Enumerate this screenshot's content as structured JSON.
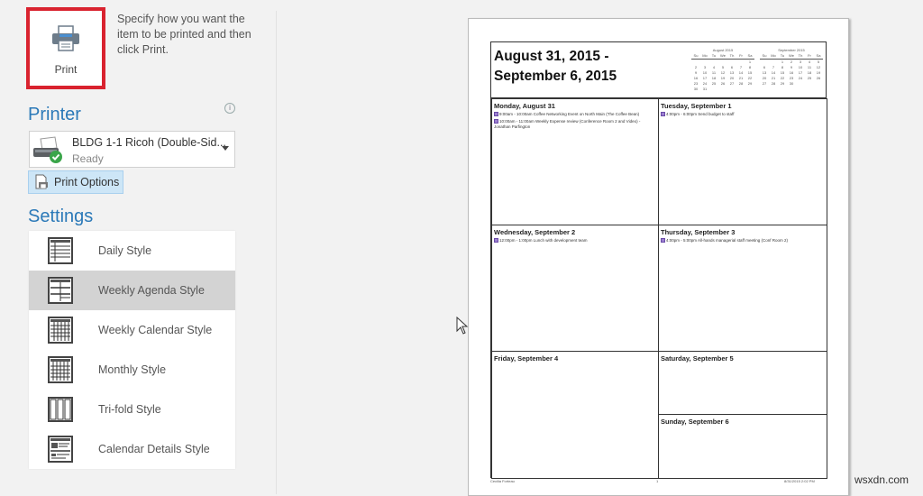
{
  "print_button": {
    "label": "Print",
    "icon": "printer-icon"
  },
  "description": "Specify how you want the item to be printed and then click Print.",
  "printer": {
    "section_title": "Printer",
    "info_icon": "info-icon",
    "selected_name": "BLDG 1-1 Ricoh (Double-Sid...",
    "status": "Ready",
    "options_label": "Print Options"
  },
  "settings": {
    "section_title": "Settings",
    "styles": [
      {
        "label": "Daily Style",
        "icon": "daily-style-icon",
        "selected": false
      },
      {
        "label": "Weekly Agenda Style",
        "icon": "weekly-agenda-style-icon",
        "selected": true
      },
      {
        "label": "Weekly Calendar Style",
        "icon": "weekly-calendar-style-icon",
        "selected": false
      },
      {
        "label": "Monthly Style",
        "icon": "monthly-style-icon",
        "selected": false
      },
      {
        "label": "Tri-fold Style",
        "icon": "trifold-style-icon",
        "selected": false
      },
      {
        "label": "Calendar Details Style",
        "icon": "calendar-details-style-icon",
        "selected": false
      }
    ]
  },
  "preview": {
    "title_line1": "August 31, 2015 -",
    "title_line2": "September 6, 2015",
    "mini_calendars": [
      {
        "month": "August 2015",
        "dows": [
          "Su",
          "Mo",
          "Tu",
          "We",
          "Th",
          "Fr",
          "Sa"
        ],
        "weeks": [
          [
            "",
            "",
            "",
            "",
            "",
            "",
            "1"
          ],
          [
            "2",
            "3",
            "4",
            "5",
            "6",
            "7",
            "8"
          ],
          [
            "9",
            "10",
            "11",
            "12",
            "13",
            "14",
            "15"
          ],
          [
            "16",
            "17",
            "18",
            "19",
            "20",
            "21",
            "22"
          ],
          [
            "23",
            "24",
            "25",
            "26",
            "27",
            "28",
            "29"
          ],
          [
            "30",
            "31",
            "",
            "",
            "",
            "",
            ""
          ]
        ]
      },
      {
        "month": "September 2015",
        "dows": [
          "Su",
          "Mo",
          "Tu",
          "We",
          "Th",
          "Fr",
          "Sa"
        ],
        "weeks": [
          [
            "",
            "",
            "1",
            "2",
            "3",
            "4",
            "5"
          ],
          [
            "6",
            "7",
            "8",
            "9",
            "10",
            "11",
            "12"
          ],
          [
            "13",
            "14",
            "15",
            "16",
            "17",
            "18",
            "19"
          ],
          [
            "20",
            "21",
            "22",
            "23",
            "24",
            "25",
            "26"
          ],
          [
            "27",
            "28",
            "29",
            "30",
            "",
            "",
            ""
          ]
        ]
      }
    ],
    "days": [
      {
        "name": "Monday, August 31",
        "appointments": [
          "9:00am - 10:00am Coffee Networking Event on North Main (The Coffee Bean)",
          "10:00am - 11:00am Weekly Expense review (Conference Room 2 and Video) - Jonathan Parfington"
        ]
      },
      {
        "name": "Tuesday, September 1",
        "appointments": [
          "4:00pm - 6:00pm Send budget to staff"
        ]
      },
      {
        "name": "Wednesday, September 2",
        "appointments": [
          "12:00pm - 1:00pm Lunch with development team"
        ]
      },
      {
        "name": "Thursday, September 3",
        "appointments": [
          "4:00pm - 5:00pm All-hands managerial staff meeting (Conf Room 2)"
        ]
      },
      {
        "name": "Friday, September 4",
        "appointments": []
      },
      {
        "name": "Saturday, September 5",
        "appointments": []
      },
      {
        "name": "Sunday, September 6",
        "appointments": []
      }
    ],
    "footer_left": "Cecilia Forteau",
    "footer_center": "1",
    "footer_right": "8/31/2015 2:02 PM"
  },
  "watermark": "wsxdn.com",
  "colors": {
    "accent": "#2b79b8",
    "print_highlight": "#d9232f",
    "selected_style_bg": "#d3d3d3",
    "appointment_swatch": "#9b7fd0"
  }
}
